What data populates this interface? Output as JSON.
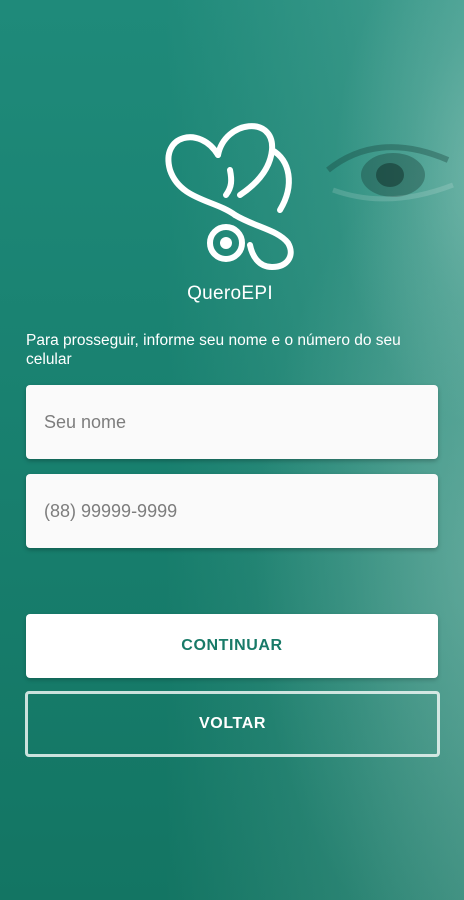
{
  "app": {
    "logo_text": "QueroEPI"
  },
  "form": {
    "prompt": "Para prosseguir, informe seu nome e o número do seu celular",
    "name_placeholder": "Seu nome",
    "name_value": "",
    "phone_placeholder": "(88) 99999-9999",
    "phone_value": ""
  },
  "actions": {
    "continue_label": "CONTINUAR",
    "back_label": "VOLTAR"
  },
  "colors": {
    "background": "#1b8574",
    "accent_text": "#187a68",
    "field_bg": "#fafafa"
  },
  "icons": {
    "logo": "heart-stethoscope-icon"
  }
}
